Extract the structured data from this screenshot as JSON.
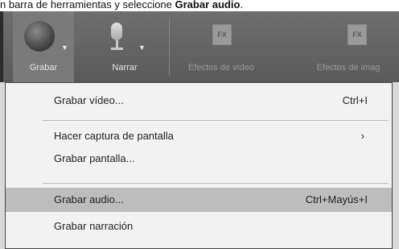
{
  "instruction": {
    "prefix": "n barra de herramientas y seleccione",
    "bold": "Grabar audio",
    "suffix": "."
  },
  "toolbar": {
    "grabar": "Grabar",
    "narrar": "Narrar",
    "efectos_video": "Efectos de vídeo",
    "efectos_imagen": "Efectos de imag",
    "fx_icon": "FX"
  },
  "menu": {
    "items": [
      {
        "label": "Grabar vídeo...",
        "shortcut": "Ctrl+I"
      },
      {
        "label": "Hacer captura de pantalla",
        "submenu": "›"
      },
      {
        "label": "Grabar pantalla..."
      },
      {
        "label": "Grabar audio...",
        "shortcut": "Ctrl+Mayús+I"
      },
      {
        "label": "Grabar narración"
      }
    ]
  }
}
